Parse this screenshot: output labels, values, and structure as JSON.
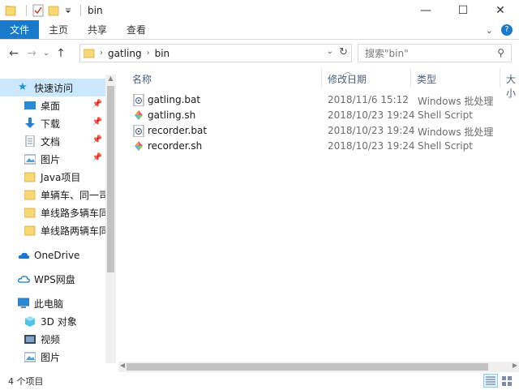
{
  "window": {
    "title": "bin",
    "controls": [
      "minimize-icon",
      "maximize-icon",
      "close-icon"
    ]
  },
  "ribbon": {
    "tabs": [
      "文件",
      "主页",
      "共享",
      "查看"
    ]
  },
  "address": {
    "crumbs": [
      "gatling",
      "bin"
    ],
    "search_placeholder": "搜索\"bin\""
  },
  "nav": {
    "items": [
      {
        "label": "快速访问",
        "icon": "star-icon"
      },
      {
        "label": "桌面",
        "icon": "desktop-icon",
        "pinned": true
      },
      {
        "label": "下载",
        "icon": "download-icon",
        "pinned": true
      },
      {
        "label": "文档",
        "icon": "document-icon",
        "pinned": true
      },
      {
        "label": "图片",
        "icon": "picture-icon",
        "pinned": true
      },
      {
        "label": "Java项目",
        "icon": "folder-icon"
      },
      {
        "label": "单辆车、同一司机",
        "icon": "folder-icon"
      },
      {
        "label": "单线路多辆车同一",
        "icon": "folder-icon"
      },
      {
        "label": "单线路两辆车同一",
        "icon": "folder-icon"
      },
      {
        "label": "OneDrive",
        "icon": "cloud-icon"
      },
      {
        "label": "WPS网盘",
        "icon": "wps-cloud-icon"
      },
      {
        "label": "此电脑",
        "icon": "computer-icon"
      },
      {
        "label": "3D 对象",
        "icon": "cube-icon"
      },
      {
        "label": "视频",
        "icon": "video-icon"
      },
      {
        "label": "图片",
        "icon": "picture-icon"
      }
    ]
  },
  "list": {
    "columns": [
      "名称",
      "修改日期",
      "类型",
      "大小"
    ],
    "files": [
      {
        "name": "gatling.bat",
        "date": "2018/11/6 15:12",
        "type": "Windows 批处理",
        "icon": "batch-file-icon"
      },
      {
        "name": "gatling.sh",
        "date": "2018/10/23 19:24",
        "type": "Shell Script",
        "icon": "shell-script-icon"
      },
      {
        "name": "recorder.bat",
        "date": "2018/10/23 19:24",
        "type": "Windows 批处理",
        "icon": "batch-file-icon"
      },
      {
        "name": "recorder.sh",
        "date": "2018/10/23 19:24",
        "type": "Shell Script",
        "icon": "shell-script-icon"
      }
    ]
  },
  "status": {
    "count": "4 个项目"
  },
  "colors": {
    "file_tab": "#1979ca",
    "selection": "#cce8ff",
    "folder": "#f8d775",
    "header_text": "#4c607a"
  }
}
